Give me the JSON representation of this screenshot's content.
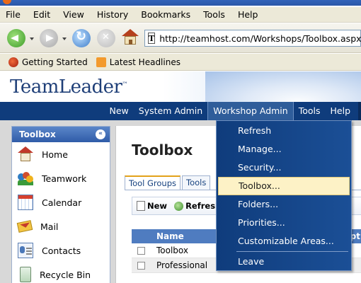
{
  "browser": {
    "menu": [
      "File",
      "Edit",
      "View",
      "History",
      "Bookmarks",
      "Tools",
      "Help"
    ],
    "url": "http://teamhost.com/Workshops/Toolbox.aspx",
    "url_favicon": "T",
    "bookmarks": [
      "Getting Started",
      "Latest Headlines"
    ]
  },
  "app": {
    "logo": "TeamLeader",
    "logo_mark": "™",
    "nav": [
      "New",
      "System Admin",
      "Workshop Admin",
      "Tools",
      "Help"
    ],
    "active_nav": "Workshop Admin"
  },
  "sidebar": {
    "title": "Toolbox",
    "collapse_glyph": "«",
    "items": [
      {
        "label": "Home",
        "icon": "home-icon"
      },
      {
        "label": "Teamwork",
        "icon": "teamwork-icon"
      },
      {
        "label": "Calendar",
        "icon": "calendar-icon"
      },
      {
        "label": "Mail",
        "icon": "mail-icon"
      },
      {
        "label": "Contacts",
        "icon": "contacts-icon"
      },
      {
        "label": "Recycle Bin",
        "icon": "recycle-bin-icon"
      }
    ]
  },
  "main": {
    "title": "Toolbox",
    "tabs": [
      "Tool Groups",
      "Tools"
    ],
    "active_tab": "Tool Groups",
    "toolbar": {
      "new_label": "New",
      "refresh_label": "Refresh"
    },
    "grid": {
      "header_name": "Name",
      "header_extra": "ript",
      "rows": [
        "Toolbox",
        "Professional"
      ]
    }
  },
  "dropdown": {
    "items": [
      "Refresh",
      "Manage...",
      "Security...",
      "Toolbox...",
      "Folders...",
      "Priorities...",
      "Customizable Areas...",
      "Leave"
    ],
    "highlighted": "Toolbox..."
  },
  "colors": {
    "nav_bg": "#0f3c7c",
    "highlight": "#fdf2c6",
    "grid_header": "#4f7cc0"
  }
}
